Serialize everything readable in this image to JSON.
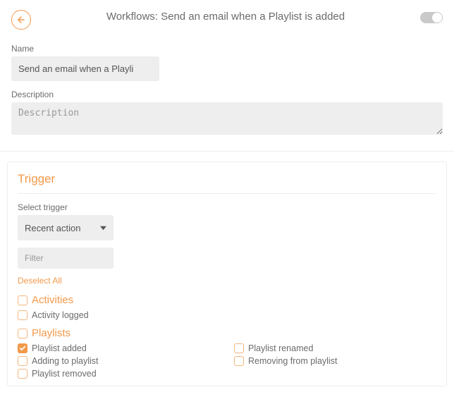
{
  "header": {
    "title": "Workflows: Send an email when a Playlist is added"
  },
  "form": {
    "name_label": "Name",
    "name_value": "Send an email when a Playli",
    "description_label": "Description",
    "description_placeholder": "Description"
  },
  "trigger": {
    "section_title": "Trigger",
    "select_label": "Select trigger",
    "select_value": "Recent action",
    "filter_placeholder": "Filter",
    "deselect_label": "Deselect All",
    "groups": [
      {
        "title": "Activities",
        "options": [
          {
            "label": "Activity logged",
            "checked": false
          }
        ]
      },
      {
        "title": "Playlists",
        "options": [
          {
            "label": "Playlist added",
            "checked": true
          },
          {
            "label": "Playlist renamed",
            "checked": false
          },
          {
            "label": "Adding to playlist",
            "checked": false
          },
          {
            "label": "Removing from playlist",
            "checked": false
          },
          {
            "label": "Playlist removed",
            "checked": false
          }
        ]
      }
    ]
  }
}
